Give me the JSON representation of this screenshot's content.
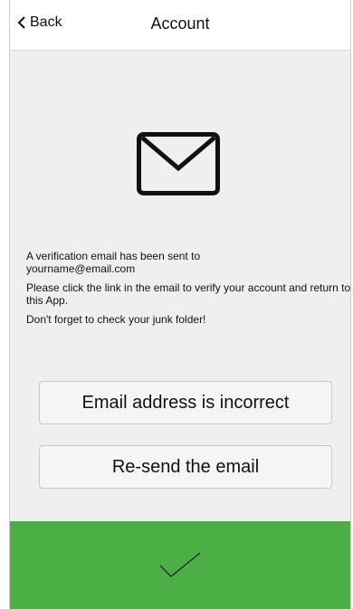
{
  "header": {
    "back_label": "Back",
    "title": "Account"
  },
  "content": {
    "icon": "envelope-icon",
    "line1": "A verification email has been sent to",
    "email": "yourname@email.com",
    "line2": "Please click the link in the email to verify your account and return to this App.",
    "line3": "Don't forget to check your junk folder!"
  },
  "buttons": {
    "incorrect_label": "Email address is incorrect",
    "resend_label": "Re-send the email"
  },
  "footer": {
    "icon": "checkmark-icon",
    "color": "#4caf45"
  }
}
